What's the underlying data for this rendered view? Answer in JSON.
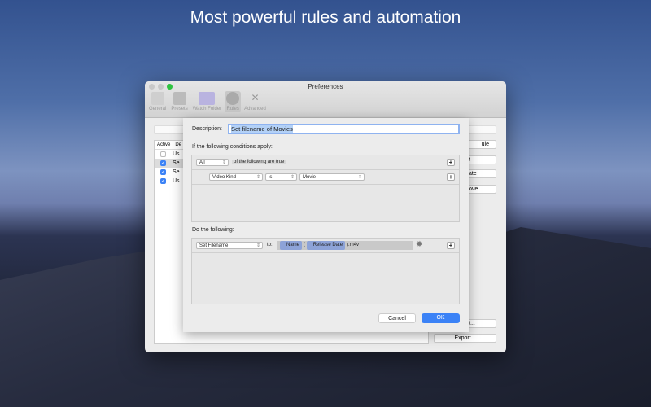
{
  "headline": "Most powerful rules and automation",
  "window": {
    "title": "Preferences",
    "toolbar": [
      {
        "label": "General"
      },
      {
        "label": "Presets"
      },
      {
        "label": "Watch Folder"
      },
      {
        "label": "Rules"
      },
      {
        "label": "Advanced"
      }
    ]
  },
  "table": {
    "headers": [
      "Active",
      "De"
    ],
    "rows": [
      {
        "text": "Us",
        "active": false
      },
      {
        "text": "Se",
        "active": true
      },
      {
        "text": "Se",
        "active": true
      },
      {
        "text": "Us",
        "active": true
      }
    ]
  },
  "side_buttons": [
    "ule",
    "t",
    "ate",
    "ove",
    "t...",
    "Export..."
  ],
  "sheet": {
    "description_label": "Description:",
    "description_value": "Set filename of Movies",
    "conditions_label": "If the following conditions apply:",
    "match": "All",
    "match_suffix": "of the following are true",
    "condition": {
      "field": "Video Kind",
      "op": "is",
      "value": "Movie"
    },
    "actions_label": "Do the following:",
    "action": {
      "type": "Set Filename",
      "to": "to:",
      "token1": "Name",
      "sep": "(",
      "token2": "Release Date",
      "suffix": ").m4v"
    },
    "cancel": "Cancel",
    "ok": "OK"
  },
  "colors": {
    "accent": "#3b82f6"
  }
}
